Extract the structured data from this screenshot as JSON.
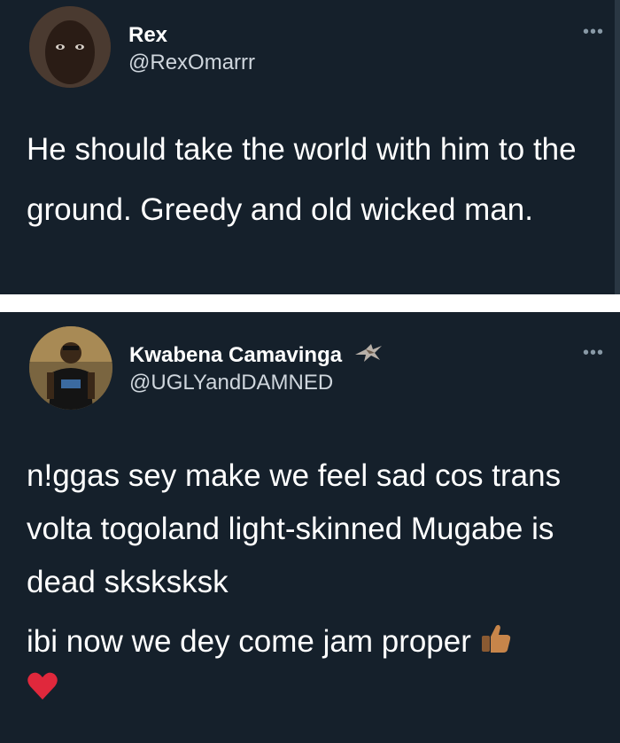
{
  "tweets": [
    {
      "display_name": "Rex",
      "handle": "@RexOmarrr",
      "more_icon": "more-horizontal-icon",
      "text": "He should take the world with him to the ground. Greedy and old wicked man."
    },
    {
      "display_name": "Kwabena Camavinga",
      "name_badge_icon": "bird-of-prey-icon",
      "handle": "@UGLYandDAMNED",
      "more_icon": "more-horizontal-icon",
      "text_1": "n!ggas sey make we feel sad cos trans volta togoland light-skinned Mugabe is dead sksksksk",
      "text_2": "ibi now we dey come jam proper",
      "emojis": [
        "thumbs-up-icon",
        "red-heart-icon"
      ]
    }
  ],
  "colors": {
    "background": "#15202b",
    "text": "#ffffff",
    "secondary": "#cfd6dd",
    "separator": "#ffffff"
  }
}
